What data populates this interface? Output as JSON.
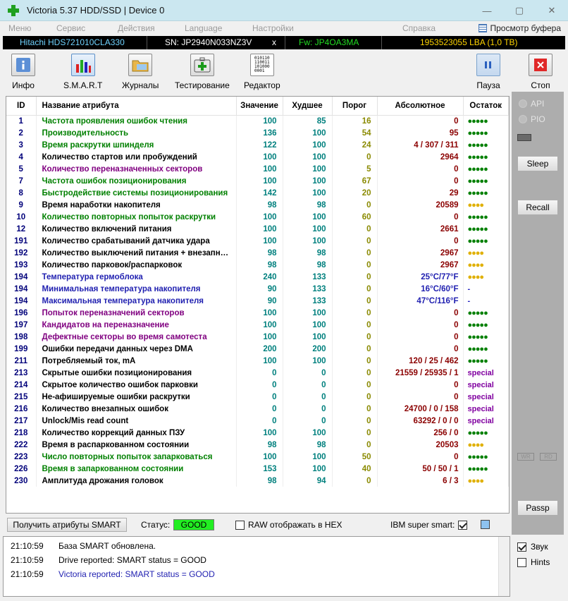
{
  "window": {
    "title": "Victoria 5.37 HDD/SSD | Device 0",
    "minimize": "—",
    "maximize": "▢",
    "close": "✕"
  },
  "menu": [
    "Меню",
    "Сервис",
    "Действия",
    "Language",
    "Настройки",
    "Справка"
  ],
  "buffer_view": "Просмотр буфера",
  "drive": {
    "model": "Hitachi HDS721010CLA330",
    "serial": "SN: JP2940N033NZ3V",
    "x": "x",
    "firmware": "Fw: JP4OA3MA",
    "capacity": "1953523055 LBA (1,0 TB)"
  },
  "toolbar": {
    "info": "Инфо",
    "smart": "S.M.A.R.T",
    "logs": "Журналы",
    "test": "Тестирование",
    "editor": "Редактор",
    "pause": "Пауза",
    "stop": "Стоп"
  },
  "table": {
    "headers": [
      "ID",
      "Название атрибута",
      "Значение",
      "Худшее",
      "Порог",
      "Абсолютное",
      "Остаток"
    ],
    "rows": [
      {
        "id": "1",
        "name": "Частота проявления ошибок чтения",
        "value": "100",
        "worst": "85",
        "threshold": "16",
        "absolute": "0",
        "remain": "●●●●●",
        "name_color": "#008000",
        "remain_type": "green"
      },
      {
        "id": "2",
        "name": "Производительность",
        "value": "136",
        "worst": "100",
        "threshold": "54",
        "absolute": "95",
        "remain": "●●●●●",
        "name_color": "#008000",
        "remain_type": "green"
      },
      {
        "id": "3",
        "name": "Время раскрутки шпинделя",
        "value": "122",
        "worst": "100",
        "threshold": "24",
        "absolute": "4 / 307 / 311",
        "remain": "●●●●●",
        "name_color": "#008000",
        "remain_type": "green"
      },
      {
        "id": "4",
        "name": "Количество стартов или пробуждений",
        "value": "100",
        "worst": "100",
        "threshold": "0",
        "absolute": "2964",
        "remain": "●●●●●",
        "name_color": "#000000",
        "remain_type": "green"
      },
      {
        "id": "5",
        "name": "Количество переназначенных секторов",
        "value": "100",
        "worst": "100",
        "threshold": "5",
        "absolute": "0",
        "remain": "●●●●●",
        "name_color": "#800080",
        "remain_type": "green"
      },
      {
        "id": "7",
        "name": "Частота ошибок позиционирования",
        "value": "100",
        "worst": "100",
        "threshold": "67",
        "absolute": "0",
        "remain": "●●●●●",
        "name_color": "#008000",
        "remain_type": "green"
      },
      {
        "id": "8",
        "name": "Быстродействие системы позиционирования",
        "value": "142",
        "worst": "100",
        "threshold": "20",
        "absolute": "29",
        "remain": "●●●●●",
        "name_color": "#008000",
        "remain_type": "green"
      },
      {
        "id": "9",
        "name": "Время наработки накопителя",
        "value": "98",
        "worst": "98",
        "threshold": "0",
        "absolute": "20589",
        "remain": "●●●●",
        "name_color": "#000000",
        "remain_type": "yellow"
      },
      {
        "id": "10",
        "name": "Количество повторных попыток раскрутки",
        "value": "100",
        "worst": "100",
        "threshold": "60",
        "absolute": "0",
        "remain": "●●●●●",
        "name_color": "#008000",
        "remain_type": "green"
      },
      {
        "id": "12",
        "name": "Количество включений питания",
        "value": "100",
        "worst": "100",
        "threshold": "0",
        "absolute": "2661",
        "remain": "●●●●●",
        "name_color": "#000000",
        "remain_type": "green"
      },
      {
        "id": "191",
        "name": "Количество срабатываний датчика удара",
        "value": "100",
        "worst": "100",
        "threshold": "0",
        "absolute": "0",
        "remain": "●●●●●",
        "name_color": "#000000",
        "remain_type": "green"
      },
      {
        "id": "192",
        "name": "Количество выключений питания + внезапн…",
        "value": "98",
        "worst": "98",
        "threshold": "0",
        "absolute": "2967",
        "remain": "●●●●",
        "name_color": "#000000",
        "remain_type": "yellow"
      },
      {
        "id": "193",
        "name": "Количество парковок/распарковок",
        "value": "98",
        "worst": "98",
        "threshold": "0",
        "absolute": "2967",
        "remain": "●●●●",
        "name_color": "#000000",
        "remain_type": "yellow"
      },
      {
        "id": "194",
        "name": "Температура гермоблока",
        "value": "240",
        "worst": "133",
        "threshold": "0",
        "absolute": "25°C/77°F",
        "remain": "●●●●",
        "name_color": "#1f1fb0",
        "remain_type": "yellow",
        "abs_color": "#1f1fb0"
      },
      {
        "id": "194",
        "name": "Минимальная температура накопителя",
        "value": "90",
        "worst": "133",
        "threshold": "0",
        "absolute": "16°C/60°F",
        "remain": "-",
        "name_color": "#1f1fb0",
        "remain_type": "dash",
        "abs_color": "#1f1fb0"
      },
      {
        "id": "194",
        "name": "Максимальная температура накопителя",
        "value": "90",
        "worst": "133",
        "threshold": "0",
        "absolute": "47°C/116°F",
        "remain": "-",
        "name_color": "#1f1fb0",
        "remain_type": "dash",
        "abs_color": "#1f1fb0"
      },
      {
        "id": "196",
        "name": "Попыток переназначений секторов",
        "value": "100",
        "worst": "100",
        "threshold": "0",
        "absolute": "0",
        "remain": "●●●●●",
        "name_color": "#800080",
        "remain_type": "green"
      },
      {
        "id": "197",
        "name": "Кандидатов на переназначение",
        "value": "100",
        "worst": "100",
        "threshold": "0",
        "absolute": "0",
        "remain": "●●●●●",
        "name_color": "#800080",
        "remain_type": "green"
      },
      {
        "id": "198",
        "name": "Дефектные секторы во время самотеста",
        "value": "100",
        "worst": "100",
        "threshold": "0",
        "absolute": "0",
        "remain": "●●●●●",
        "name_color": "#800080",
        "remain_type": "green"
      },
      {
        "id": "199",
        "name": "Ошибки передачи данных через DMA",
        "value": "200",
        "worst": "200",
        "threshold": "0",
        "absolute": "0",
        "remain": "●●●●●",
        "name_color": "#000000",
        "remain_type": "green"
      },
      {
        "id": "211",
        "name": "Потребляемый ток, mA",
        "value": "100",
        "worst": "100",
        "threshold": "0",
        "absolute": "120 / 25 / 462",
        "remain": "●●●●●",
        "name_color": "#000000",
        "remain_type": "green"
      },
      {
        "id": "213",
        "name": "Скрытые ошибки позиционирования",
        "value": "0",
        "worst": "0",
        "threshold": "0",
        "absolute": "21559 / 25935 / 1",
        "remain": "special",
        "name_color": "#000000",
        "remain_type": "special"
      },
      {
        "id": "214",
        "name": "Скрытое количество ошибок парковки",
        "value": "0",
        "worst": "0",
        "threshold": "0",
        "absolute": "0",
        "remain": "special",
        "name_color": "#000000",
        "remain_type": "special"
      },
      {
        "id": "215",
        "name": "Не-афишируемые ошибки раскрутки",
        "value": "0",
        "worst": "0",
        "threshold": "0",
        "absolute": "0",
        "remain": "special",
        "name_color": "#000000",
        "remain_type": "special"
      },
      {
        "id": "216",
        "name": "Количество внезапных ошибок",
        "value": "0",
        "worst": "0",
        "threshold": "0",
        "absolute": "24700 / 0 / 158",
        "remain": "special",
        "name_color": "#000000",
        "remain_type": "special"
      },
      {
        "id": "217",
        "name": "Unlock/Mis read count",
        "value": "0",
        "worst": "0",
        "threshold": "0",
        "absolute": "63292 / 0 / 0",
        "remain": "special",
        "name_color": "#000000",
        "remain_type": "special"
      },
      {
        "id": "218",
        "name": "Количество коррекций данных ПЗУ",
        "value": "100",
        "worst": "100",
        "threshold": "0",
        "absolute": "256 / 0",
        "remain": "●●●●●",
        "name_color": "#000000",
        "remain_type": "green"
      },
      {
        "id": "222",
        "name": "Время в распаркованном состоянии",
        "value": "98",
        "worst": "98",
        "threshold": "0",
        "absolute": "20503",
        "remain": "●●●●",
        "name_color": "#000000",
        "remain_type": "yellow"
      },
      {
        "id": "223",
        "name": "Число повторных попыток запарковаться",
        "value": "100",
        "worst": "100",
        "threshold": "50",
        "absolute": "0",
        "remain": "●●●●●",
        "name_color": "#008000",
        "remain_type": "green"
      },
      {
        "id": "226",
        "name": "Время в запаркованном состоянии",
        "value": "153",
        "worst": "100",
        "threshold": "40",
        "absolute": "50 / 50 / 1",
        "remain": "●●●●●",
        "name_color": "#008000",
        "remain_type": "green"
      },
      {
        "id": "230",
        "name": "Амплитуда дрожания головок",
        "value": "98",
        "worst": "94",
        "threshold": "0",
        "absolute": "6 / 3",
        "remain": "●●●●",
        "name_color": "#000000",
        "remain_type": "yellow"
      }
    ]
  },
  "status_bar": {
    "get_smart": "Получить атрибуты SMART",
    "status_label": "Статус:",
    "status_value": "GOOD",
    "raw_hex": "RAW отображать в HEX",
    "ibm_super_smart": "IBM super smart:"
  },
  "side": {
    "api": "API",
    "pio": "PIO",
    "sleep": "Sleep",
    "recall": "Recall",
    "passp": "Passp",
    "wr": "WR",
    "rd": "RD"
  },
  "log": [
    {
      "time": "21:10:59",
      "text": "База SMART обновлена.",
      "color": "#000000"
    },
    {
      "time": "21:10:59",
      "text": "Drive reported: SMART status = GOOD",
      "color": "#000000"
    },
    {
      "time": "21:10:59",
      "text": "Victoria reported: SMART status = GOOD",
      "color": "#1f1fb0"
    }
  ],
  "options": {
    "sound": "Звук",
    "hints": "Hints"
  },
  "colors": {
    "titlebar": "#cbe7f0",
    "good": "#22ee22",
    "model": "#6fd3ff",
    "firmware": "#22dd22",
    "capacity": "#ffd400"
  }
}
